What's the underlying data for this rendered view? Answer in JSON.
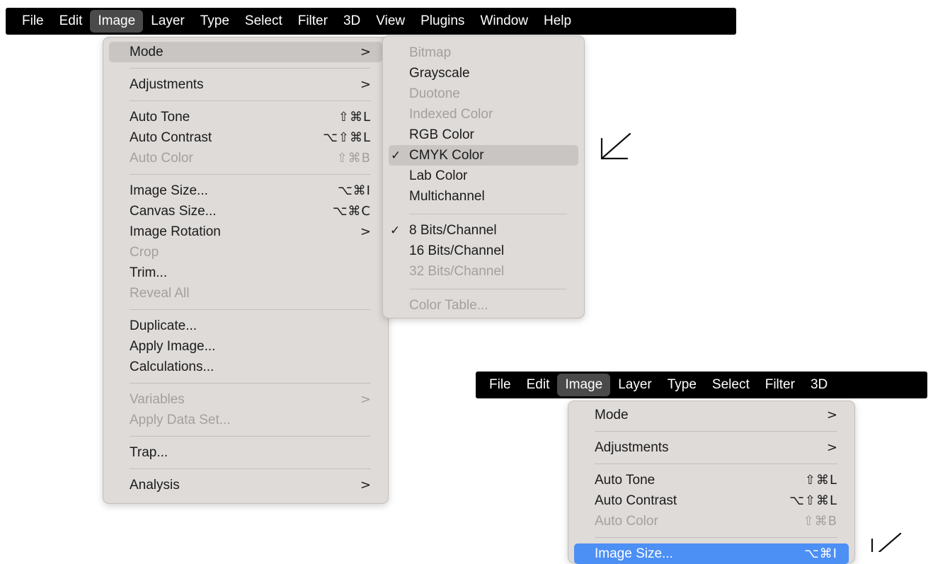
{
  "menubar_top": {
    "items": [
      "File",
      "Edit",
      "Image",
      "Layer",
      "Type",
      "Select",
      "Filter",
      "3D",
      "View",
      "Plugins",
      "Window",
      "Help"
    ],
    "active_index": 2
  },
  "image_menu": {
    "mode": "Mode",
    "adjustments": "Adjustments",
    "auto_tone": "Auto Tone",
    "auto_tone_sc": "⇧⌘L",
    "auto_contrast": "Auto Contrast",
    "auto_contrast_sc": "⌥⇧⌘L",
    "auto_color": "Auto Color",
    "auto_color_sc": "⇧⌘B",
    "image_size": "Image Size...",
    "image_size_sc": "⌥⌘I",
    "canvas_size": "Canvas Size...",
    "canvas_size_sc": "⌥⌘C",
    "image_rotation": "Image Rotation",
    "crop": "Crop",
    "trim": "Trim...",
    "reveal_all": "Reveal All",
    "duplicate": "Duplicate...",
    "apply_image": "Apply Image...",
    "calculations": "Calculations...",
    "variables": "Variables",
    "apply_data_set": "Apply Data Set...",
    "trap": "Trap...",
    "analysis": "Analysis",
    "submenu_arrow": ">"
  },
  "mode_submenu": {
    "bitmap": "Bitmap",
    "grayscale": "Grayscale",
    "duotone": "Duotone",
    "indexed_color": "Indexed Color",
    "rgb_color": "RGB Color",
    "cmyk_color": "CMYK Color",
    "lab_color": "Lab Color",
    "multichannel": "Multichannel",
    "bits8": "8 Bits/Channel",
    "bits16": "16 Bits/Channel",
    "bits32": "32 Bits/Channel",
    "color_table": "Color Table...",
    "checkmark": "✓"
  },
  "menubar_bottom": {
    "items": [
      "File",
      "Edit",
      "Image",
      "Layer",
      "Type",
      "Select",
      "Filter",
      "3D"
    ],
    "active_index": 2
  },
  "image_menu_2": {
    "mode": "Mode",
    "adjustments": "Adjustments",
    "auto_tone": "Auto Tone",
    "auto_tone_sc": "⇧⌘L",
    "auto_contrast": "Auto Contrast",
    "auto_contrast_sc": "⌥⇧⌘L",
    "auto_color": "Auto Color",
    "auto_color_sc": "⇧⌘B",
    "image_size": "Image Size...",
    "image_size_sc": "⌥⌘I",
    "submenu_arrow": ">"
  },
  "colors": {
    "menubar_bg": "#000000",
    "menu_bg": "#dedbd9",
    "highlight": "#c8c5c3",
    "selected_blue": "#4c8ff5",
    "disabled_text": "#a3a09d"
  },
  "icons": {
    "annotation_arrow": "arrow-down-left-icon"
  }
}
